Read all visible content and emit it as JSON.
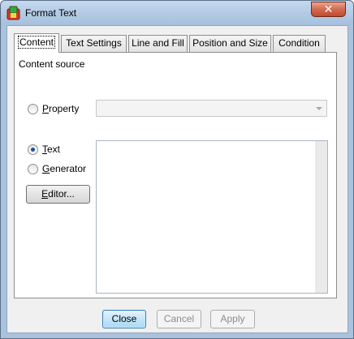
{
  "window": {
    "title": "Format Text",
    "close_symbol": "✕"
  },
  "tabs": [
    {
      "label": "Content",
      "active": true
    },
    {
      "label": "Text Settings",
      "active": false
    },
    {
      "label": "Line and Fill",
      "active": false
    },
    {
      "label": "Position and Size",
      "active": false
    },
    {
      "label": "Condition",
      "active": false
    }
  ],
  "content": {
    "group_label": "Content source",
    "property": {
      "label_accel": "P",
      "label_rest": "roperty",
      "checked": false,
      "value": ""
    },
    "text": {
      "label_accel": "T",
      "label_rest": "ext",
      "checked": true
    },
    "generator": {
      "label_accel": "G",
      "label_rest": "enerator",
      "checked": false
    },
    "editor_button": {
      "label_accel": "E",
      "label_rest": "ditor..."
    },
    "text_value": ""
  },
  "footer": {
    "close": "Close",
    "cancel": "Cancel",
    "apply": "Apply"
  },
  "icons": {
    "app": "app-icon",
    "dropdown": "chevron-down-icon"
  },
  "colors": {
    "titlebar": "#b3cbe5",
    "close_button": "#d26a4f",
    "radio_dot": "#1e4f8f"
  }
}
